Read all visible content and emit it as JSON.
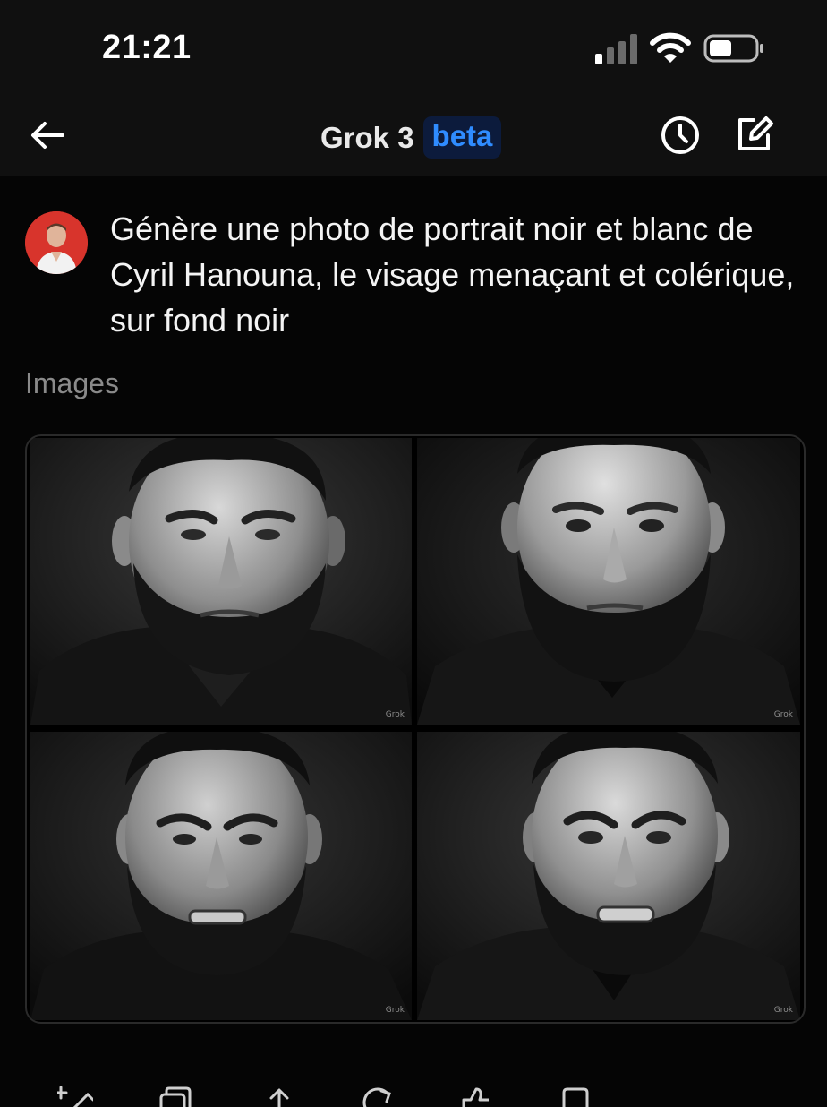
{
  "status_bar": {
    "time": "21:21"
  },
  "header": {
    "title": "Grok 3",
    "badge": "beta"
  },
  "message": {
    "text": "Génère une photo de portrait noir et blanc de Cyril Hanouna, le visage menaçant et colérique, sur fond noir"
  },
  "images_section": {
    "label": "Images",
    "watermark": "Grok",
    "tiles": [
      {
        "icon": "portrait-image-1"
      },
      {
        "icon": "portrait-image-2"
      },
      {
        "icon": "portrait-image-3"
      },
      {
        "icon": "portrait-image-4"
      }
    ]
  },
  "colors": {
    "background": "#050505",
    "header_bg": "#101010",
    "badge_bg": "#0c1b3c",
    "badge_text": "#2f8cff",
    "muted_text": "#8a8a8a",
    "avatar_bg": "#d8342c"
  },
  "action_bar": {
    "icons": [
      "edit-sparkle-icon",
      "copy-icon",
      "share-icon",
      "regenerate-icon",
      "like-icon",
      "bookmark-icon"
    ]
  }
}
